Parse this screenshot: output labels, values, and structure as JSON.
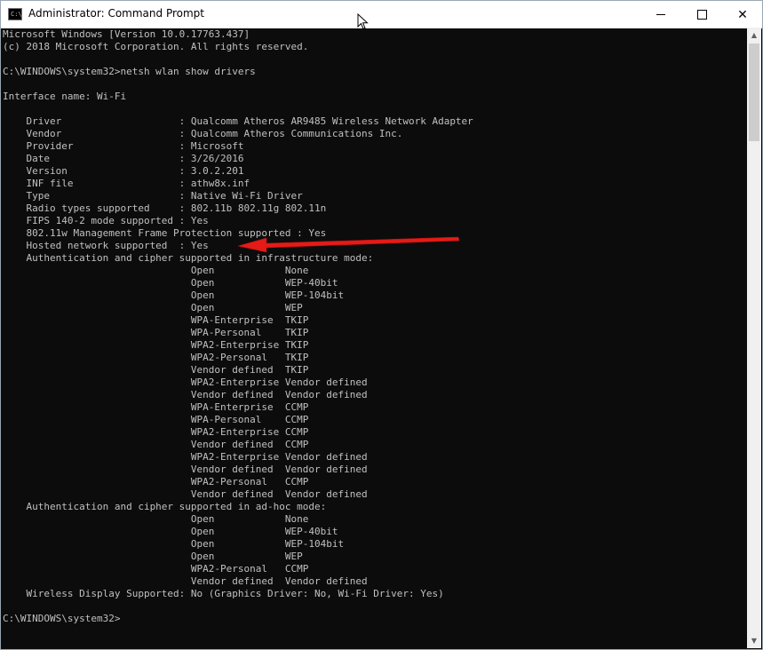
{
  "window": {
    "title": "Administrator: Command Prompt",
    "icon": "cmd-icon",
    "icon_label": "C:\\",
    "controls": {
      "minimize": "minimize-icon",
      "maximize": "maximize-icon",
      "close": "close-icon",
      "close_glyph": "✕"
    }
  },
  "console": {
    "lines": [
      "Microsoft Windows [Version 10.0.17763.437]",
      "(c) 2018 Microsoft Corporation. All rights reserved.",
      "",
      "C:\\WINDOWS\\system32>netsh wlan show drivers",
      "",
      "Interface name: Wi-Fi",
      "",
      "    Driver                    : Qualcomm Atheros AR9485 Wireless Network Adapter",
      "    Vendor                    : Qualcomm Atheros Communications Inc.",
      "    Provider                  : Microsoft",
      "    Date                      : 3/26/2016",
      "    Version                   : 3.0.2.201",
      "    INF file                  : athw8x.inf",
      "    Type                      : Native Wi-Fi Driver",
      "    Radio types supported     : 802.11b 802.11g 802.11n",
      "    FIPS 140-2 mode supported : Yes",
      "    802.11w Management Frame Protection supported : Yes",
      "    Hosted network supported  : Yes",
      "    Authentication and cipher supported in infrastructure mode:",
      "                                Open            None",
      "                                Open            WEP-40bit",
      "                                Open            WEP-104bit",
      "                                Open            WEP",
      "                                WPA-Enterprise  TKIP",
      "                                WPA-Personal    TKIP",
      "                                WPA2-Enterprise TKIP",
      "                                WPA2-Personal   TKIP",
      "                                Vendor defined  TKIP",
      "                                WPA2-Enterprise Vendor defined",
      "                                Vendor defined  Vendor defined",
      "                                WPA-Enterprise  CCMP",
      "                                WPA-Personal    CCMP",
      "                                WPA2-Enterprise CCMP",
      "                                Vendor defined  CCMP",
      "                                WPA2-Enterprise Vendor defined",
      "                                Vendor defined  Vendor defined",
      "                                WPA2-Personal   CCMP",
      "                                Vendor defined  Vendor defined",
      "    Authentication and cipher supported in ad-hoc mode:",
      "                                Open            None",
      "                                Open            WEP-40bit",
      "                                Open            WEP-104bit",
      "                                Open            WEP",
      "                                WPA2-Personal   CCMP",
      "                                Vendor defined  Vendor defined",
      "    Wireless Display Supported: No (Graphics Driver: No, Wi-Fi Driver: Yes)",
      "",
      "C:\\WINDOWS\\system32>"
    ]
  },
  "scrollbar": {
    "up_icon": "scroll-up-arrow-icon",
    "down_icon": "scroll-down-arrow-icon",
    "up_glyph": "▲",
    "down_glyph": "▼"
  },
  "annotation": {
    "icon": "red-arrow-icon",
    "color": "#e41b17"
  },
  "colors": {
    "console_bg": "#0c0c0c",
    "console_text": "#c0c0c0",
    "titlebar_bg": "#ffffff"
  }
}
